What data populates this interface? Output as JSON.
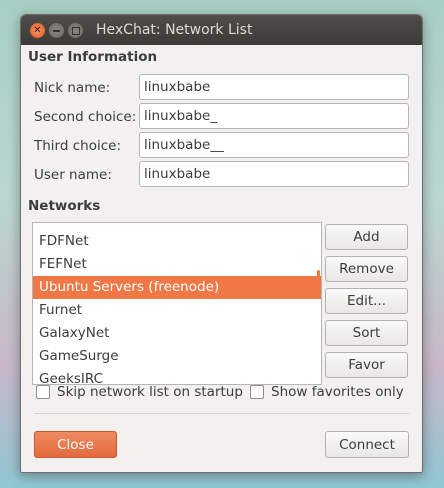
{
  "window": {
    "title": "HexChat: Network List"
  },
  "user_info": {
    "heading": "User Information",
    "fields": [
      {
        "label": "Nick name:",
        "value": "linuxbabe"
      },
      {
        "label": "Second choice:",
        "value": "linuxbabe_"
      },
      {
        "label": "Third choice:",
        "value": "linuxbabe__"
      },
      {
        "label": "User name:",
        "value": "linuxbabe"
      }
    ]
  },
  "networks": {
    "heading": "Networks",
    "items": [
      "FDFNet",
      "FEFNet",
      "Ubuntu Servers (freenode)",
      "Furnet",
      "GalaxyNet",
      "GameSurge",
      "GeeksIRC"
    ],
    "selected": "Ubuntu Servers (freenode)",
    "buttons": {
      "add": "Add",
      "remove": "Remove",
      "edit": "Edit...",
      "sort": "Sort",
      "favor": "Favor"
    }
  },
  "options": {
    "skip_label": "Skip network list on startup",
    "skip_checked": false,
    "favorites_label": "Show favorites only",
    "favorites_checked": false
  },
  "footer": {
    "close_label": "Close",
    "connect_label": "Connect"
  },
  "colors": {
    "accent": "#f07746",
    "titlebar": "#3c3b37",
    "window_bg": "#f2f1f0"
  }
}
